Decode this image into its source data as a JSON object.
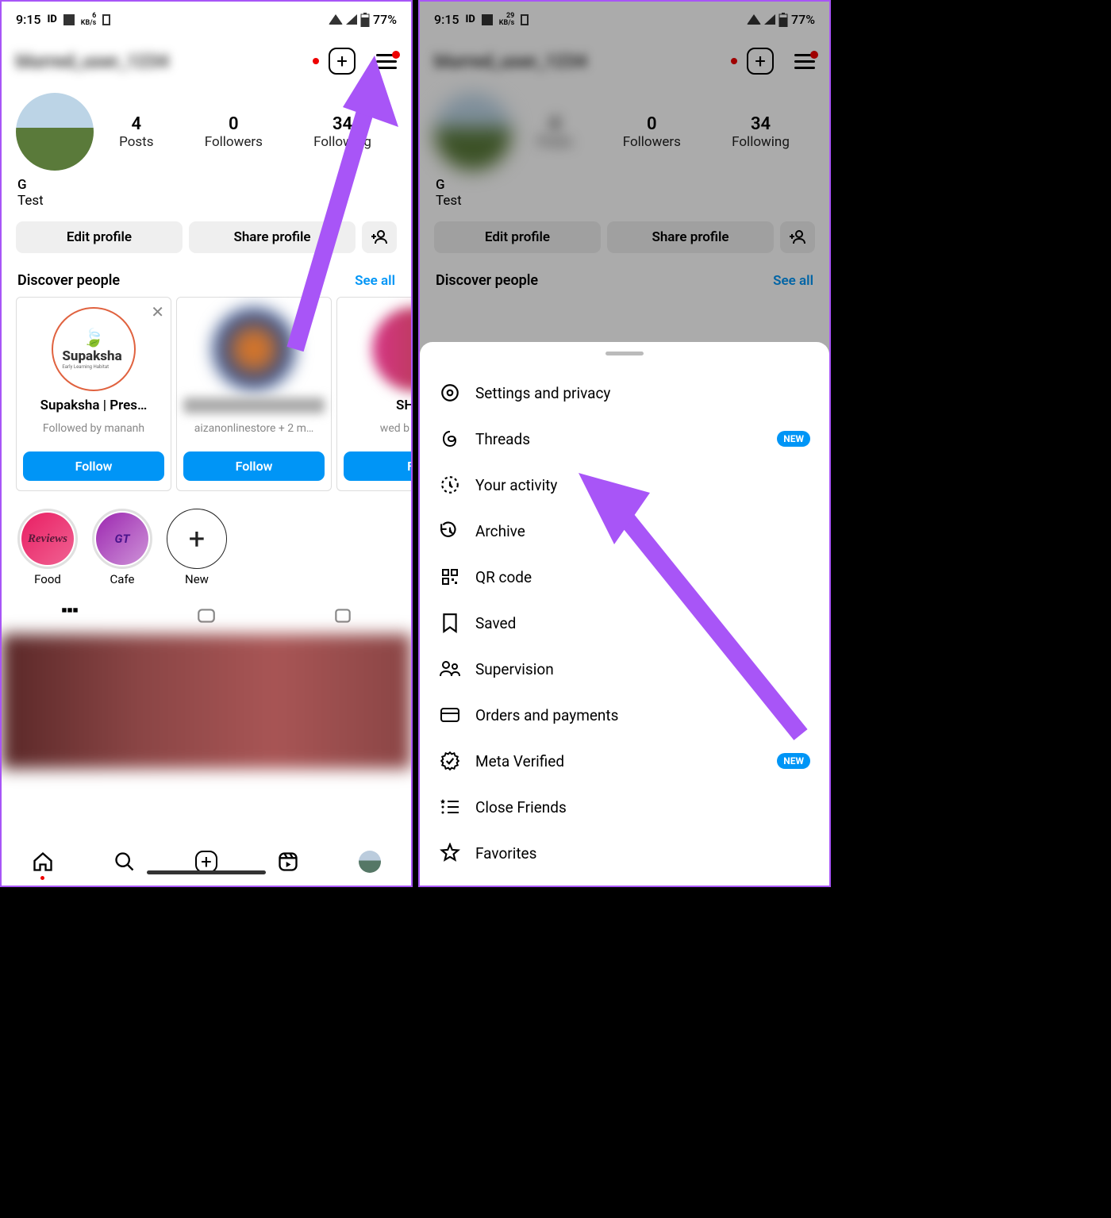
{
  "statusbar": {
    "time": "9:15",
    "kb1": "6",
    "kb2": "KB/s",
    "kb1b": "29",
    "battery": "77%"
  },
  "appbar": {
    "username": "blurred_user_1234"
  },
  "stats": [
    {
      "num": "4",
      "lbl": "Posts"
    },
    {
      "num": "0",
      "lbl": "Followers"
    },
    {
      "num": "34",
      "lbl": "Following"
    }
  ],
  "stats2": [
    {
      "num": "4",
      "lbl": "Posts"
    },
    {
      "num": "0",
      "lbl": "Followers"
    },
    {
      "num": "34",
      "lbl": "Following"
    }
  ],
  "bio": {
    "name": "G",
    "desc": "Test"
  },
  "actions": {
    "edit": "Edit profile",
    "share": "Share profile"
  },
  "discover": {
    "title": "Discover people",
    "link": "See all"
  },
  "cards": [
    {
      "name": "Supaksha | Pres…",
      "sub": "Followed by mananh",
      "btn": "Follow",
      "logo": "Supaksha",
      "tag": "Early Learning Habitat"
    },
    {
      "name": "blurred name",
      "sub": "aizanonlinestore + 2 m…",
      "btn": "Follow"
    },
    {
      "name": "SHAH",
      "sub": "wed b _by_naj",
      "btn": "Fo"
    }
  ],
  "highlights": [
    {
      "label": "Food",
      "text": "Reviews",
      "bg": "linear-gradient(135deg,#e91e63,#f06292)",
      "color": "#5a1a3a"
    },
    {
      "label": "Cafe",
      "text": "GT",
      "bg": "linear-gradient(135deg,#9c27b0,#ba68c8)",
      "color": "#4a148c"
    },
    {
      "label": "New",
      "new": true
    }
  ],
  "menu": [
    {
      "icon": "settings",
      "label": "Settings and privacy"
    },
    {
      "icon": "threads",
      "label": "Threads",
      "badge": "NEW"
    },
    {
      "icon": "activity",
      "label": "Your activity"
    },
    {
      "icon": "archive",
      "label": "Archive"
    },
    {
      "icon": "qr",
      "label": "QR code"
    },
    {
      "icon": "saved",
      "label": "Saved"
    },
    {
      "icon": "supervision",
      "label": "Supervision"
    },
    {
      "icon": "orders",
      "label": "Orders and payments"
    },
    {
      "icon": "verified",
      "label": "Meta Verified",
      "badge": "NEW"
    },
    {
      "icon": "closefriends",
      "label": "Close Friends"
    },
    {
      "icon": "favorites",
      "label": "Favorites"
    }
  ]
}
